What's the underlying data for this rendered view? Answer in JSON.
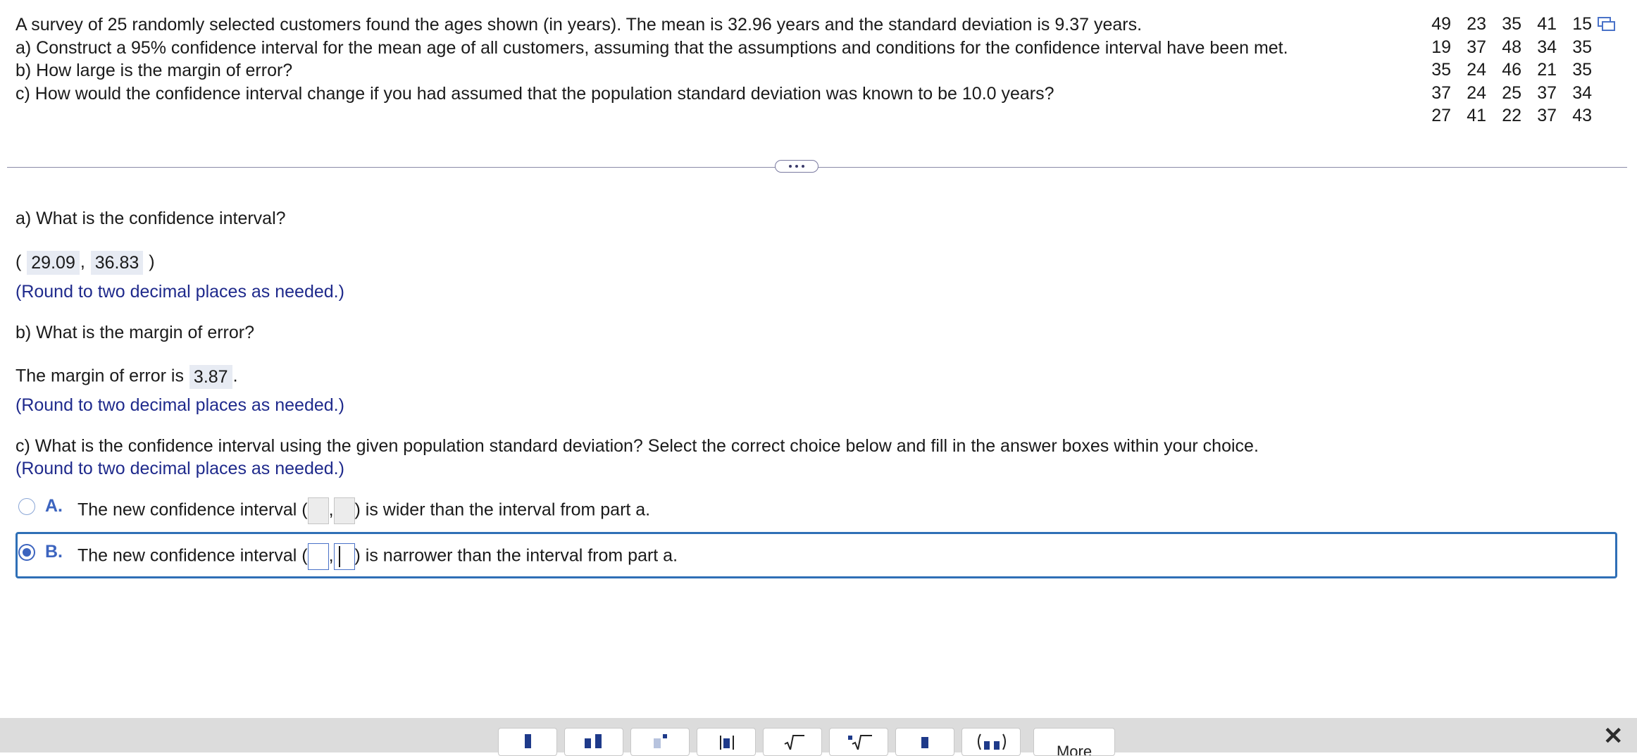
{
  "problem": {
    "lines": [
      "A survey of 25 randomly selected customers found the ages shown (in years). The mean is 32.96 years and the standard deviation is 9.37 years.",
      "a) Construct a 95% confidence interval for the mean age of all customers, assuming that the assumptions and conditions for the confidence interval have been met.",
      "b) How large is the margin of error?",
      "c) How would the confidence interval change if you had assumed that the population standard deviation was known to be 10.0 years?"
    ]
  },
  "data_table": {
    "rows": [
      [
        "49",
        "23",
        "35",
        "41",
        "15"
      ],
      [
        "19",
        "37",
        "48",
        "34",
        "35"
      ],
      [
        "35",
        "24",
        "46",
        "21",
        "35"
      ],
      [
        "37",
        "24",
        "25",
        "37",
        "34"
      ],
      [
        "27",
        "41",
        "22",
        "37",
        "43"
      ]
    ]
  },
  "part_a": {
    "question": "a) What is the confidence interval?",
    "open_paren": "(",
    "lower": "29.09",
    "comma": ",",
    "upper": "36.83",
    "close_paren": ")",
    "hint": "(Round to two decimal places as needed.)"
  },
  "part_b": {
    "question": "b) What is the margin of error?",
    "prefix": "The margin of error is",
    "value": "3.87",
    "suffix": ".",
    "hint": "(Round to two decimal places as needed.)"
  },
  "part_c": {
    "question": "c) What is the confidence interval using the given population standard deviation? Select the correct choice below and fill in the answer boxes within your choice.",
    "hint": "(Round to two decimal places as needed.)",
    "choices": [
      {
        "letter": "A.",
        "prefix": "The new confidence interval (",
        "comma": ",",
        "suffix": ") is wider than the interval from part a.",
        "selected": false
      },
      {
        "letter": "B.",
        "prefix": "The new confidence interval (",
        "comma": ",",
        "suffix": ") is narrower than the interval from part a.",
        "selected": true
      }
    ]
  },
  "toolbar": {
    "more_label": "More"
  },
  "colors": {
    "accent": "#3c64bf",
    "hint_text": "#1f2a8c",
    "selected_frame": "#2f6fb6",
    "toolbar_bg": "#dcdcdc"
  }
}
